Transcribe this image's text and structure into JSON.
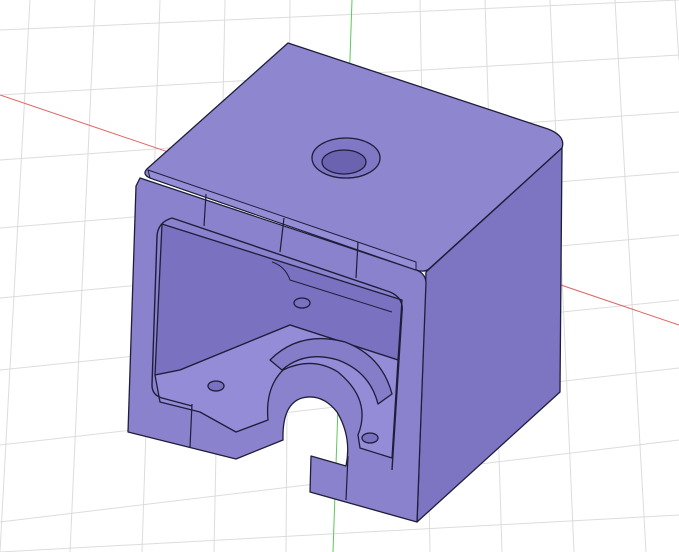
{
  "viewport": {
    "background_color": "#ffffff",
    "grid_color": "#dcdcdc",
    "x_axis_color": "#e06464",
    "y_axis_color": "#5cc85c"
  },
  "model": {
    "colors": {
      "top": "#8e86cf",
      "right": "#7d74c2",
      "front": "#8a82cc",
      "cavity_back": "#7a71c0",
      "cavity_floor": "#948cd6",
      "edge": "#1e1e3a"
    }
  }
}
